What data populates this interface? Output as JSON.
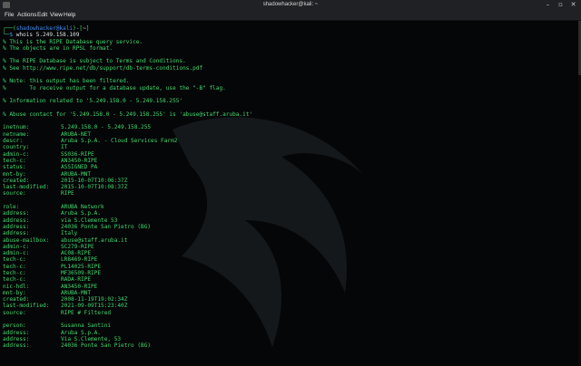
{
  "window": {
    "title": "shadowhacker@kali: ~"
  },
  "menu": [
    "File",
    "Actions",
    "Edit",
    "View",
    "Help"
  ],
  "prompt": {
    "user_host": "shadowhacker@kali",
    "path": "~",
    "symbol": "$",
    "command": "whois 5.249.158.109"
  },
  "comments": [
    "% This is the RIPE Database query service.",
    "% The objects are in RPSL format.",
    "",
    "% The RIPE Database is subject to Terms and Conditions.",
    "% See http://www.ripe.net/db/support/db-terms-conditions.pdf",
    "",
    "% Note: this output has been filtered.",
    "%       To receive output for a database update, use the \"-B\" flag.",
    "",
    "% Information related to '5.249.158.0 - 5.249.158.255'",
    "",
    "% Abuse contact for '5.249.158.0 - 5.249.158.255' is 'abuse@staff.aruba.it'",
    ""
  ],
  "records": [
    [
      "inetnum:",
      "5.249.158.0 - 5.249.158.255"
    ],
    [
      "netname:",
      "ARUBA-NET"
    ],
    [
      "descr:",
      "Aruba S.p.A. - Cloud Services Farm2"
    ],
    [
      "country:",
      "IT"
    ],
    [
      "admin-c:",
      "SS036-RIPE"
    ],
    [
      "tech-c:",
      "AN3450-RIPE"
    ],
    [
      "status:",
      "ASSIGNED PA"
    ],
    [
      "mnt-by:",
      "ARUBA-MNT"
    ],
    [
      "created:",
      "2015-10-07T10:06:37Z"
    ],
    [
      "last-modified:",
      "2015-10-07T10:08:37Z"
    ],
    [
      "source:",
      "RIPE"
    ],
    [
      "",
      ""
    ],
    [
      "role:",
      "ARUBA Network"
    ],
    [
      "address:",
      "Aruba S.p.A."
    ],
    [
      "address:",
      "via S.Clemente 53"
    ],
    [
      "address:",
      "24036 Ponte San Pietro (BG)"
    ],
    [
      "address:",
      "Italy"
    ],
    [
      "abuse-mailbox:",
      "abuse@staff.aruba.it"
    ],
    [
      "admin-c:",
      "SC279-RIPE"
    ],
    [
      "admin-c:",
      "AC08-RIPE"
    ],
    [
      "tech-c:",
      "LR8469-RIPE"
    ],
    [
      "tech-c:",
      "PL14025-RIPE"
    ],
    [
      "tech-c:",
      "MF36509-RIPE"
    ],
    [
      "tech-c:",
      "RADA-RIPE"
    ],
    [
      "nic-hdl:",
      "AN3450-RIPE"
    ],
    [
      "mnt-by:",
      "ARUBA-MNT"
    ],
    [
      "created:",
      "2008-11-19T19:02:34Z"
    ],
    [
      "last-modified:",
      "2021-09-09T15:23:40Z"
    ],
    [
      "source:",
      "RIPE # Filtered"
    ],
    [
      "",
      ""
    ],
    [
      "person:",
      "Susanna Santini"
    ],
    [
      "address:",
      "Aruba S.p.A."
    ],
    [
      "address:",
      "Via S.Clemente, 53"
    ],
    [
      "address:",
      "24036 Ponte San Pietro (BG)"
    ]
  ],
  "colors": {
    "text_green": "#41d96f",
    "prompt_blue": "#3c8cf0",
    "background": "#050607",
    "chrome": "#202124"
  }
}
